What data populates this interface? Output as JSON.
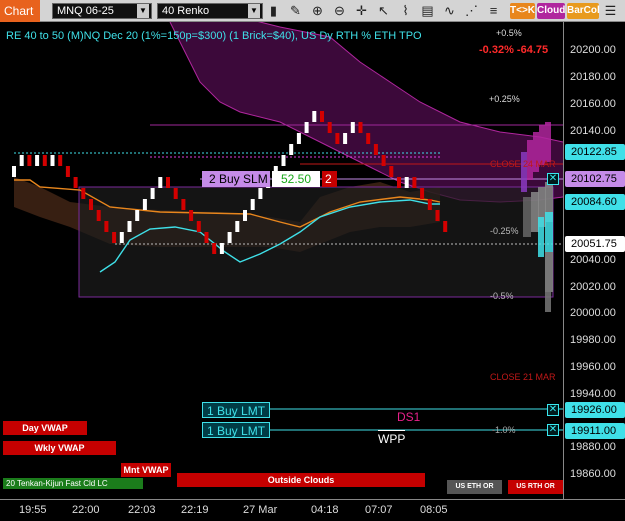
{
  "toolbar": {
    "chart_tab": "Chart",
    "instrument": "MNQ 06-25",
    "bar_type": "40 Renko",
    "tk_button": "T<>K",
    "cloud_button": "Cloud",
    "barcol_button": "BarCol"
  },
  "chart": {
    "title": "RE 40 to 50 (M)NQ Dec 20 (1%=150p=$300) (1 Brick=$40), US Dy RTH % ETH TPO",
    "change_pct": "-0.32%",
    "change_pts": "-64.75",
    "annotations": {
      "pct_p05": "+0.5%",
      "pct_p025": "+0.25%",
      "pct_m025": "-0.25%",
      "pct_m05": "-0.5%",
      "pct_m1": "-1.0%",
      "close_24": "CLOSE 24 MAR",
      "close_21": "CLOSE 21 MAR",
      "ds1": "DS1",
      "wpp": "WPP",
      "outside_clouds": "Outside Clouds",
      "us_eth_or": "US ETH OR",
      "us_rth_or": "US RTH OR"
    },
    "buttons": {
      "day_vwap": "Day VWAP",
      "wkly_vwap": "Wkly VWAP",
      "mnt_vwap": "Mnt VWAP",
      "indicator": "20 Tenkan-Kijun Fast Cld LC"
    },
    "orders": {
      "buy_slm": "2 Buy SLM",
      "buy_slm_offset": "52.50",
      "buy_slm_qty": "2",
      "buy_lmt_1": "1 Buy LMT",
      "buy_lmt_2": "1 Buy LMT"
    }
  },
  "price_axis": {
    "labels": [
      "20200.00",
      "20180.00",
      "20160.00",
      "20140.00",
      "20040.00",
      "20020.00",
      "20000.00",
      "19980.00",
      "19960.00",
      "19940.00",
      "19880.00",
      "19860.00"
    ],
    "tags": [
      {
        "price": "20122.85",
        "color": "#3fe0e8"
      },
      {
        "price": "20102.75",
        "color": "#c58be8"
      },
      {
        "price": "20084.60",
        "color": "#3fe0e8"
      },
      {
        "price": "20051.75",
        "color": "#ffffff"
      },
      {
        "price": "19926.00",
        "color": "#3fe0e8"
      },
      {
        "price": "19911.00",
        "color": "#3fe0e8"
      }
    ]
  },
  "time_axis": {
    "labels": [
      "19:55",
      "22:00",
      "22:03",
      "22:19",
      "27 Mar",
      "04:18",
      "07:07",
      "08:05"
    ]
  },
  "colors": {
    "bull": "#ffffff",
    "bear": "#d40000",
    "kijun": "#e8861d",
    "tenkan": "#3fe0e8",
    "cloud": "#a01a9c",
    "range_box": "#7a2a9a"
  }
}
